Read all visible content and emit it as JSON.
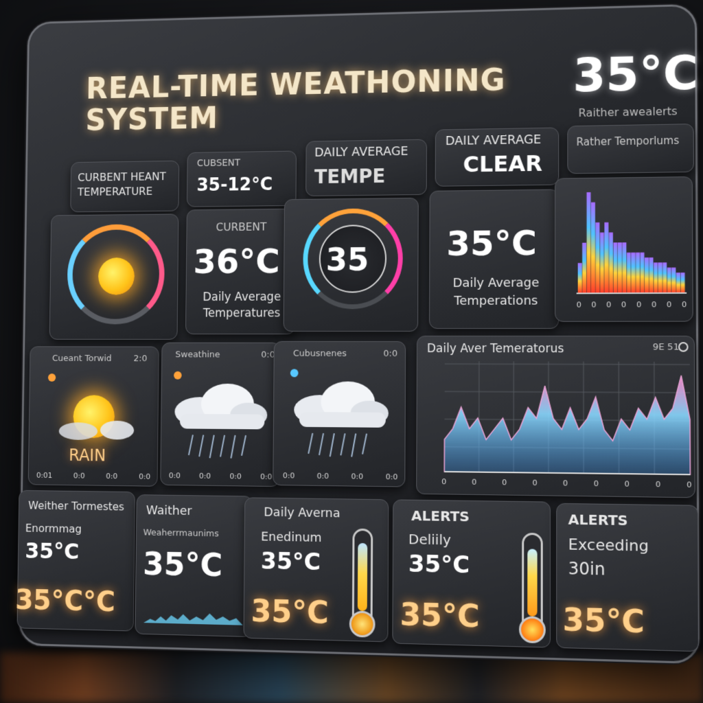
{
  "app": {
    "title": "REAL-TIME WEATHONING SYSTEM",
    "header_temp": "35°C",
    "header_alerts": "Raither awealerts"
  },
  "row1": {
    "c1": {
      "label": "CURBENT HEANT TEMPERATURE"
    },
    "c2": {
      "label": "CUBSENT",
      "value": "35-12°C"
    },
    "c3": {
      "label": "DAILY AVERAGE",
      "value": "TEMPE"
    },
    "c4": {
      "label": "DAILY AVERAGE",
      "value": "CLEAR"
    },
    "c5": {
      "label": "Rather Temporlums"
    }
  },
  "row2": {
    "c2": {
      "label": "CURBENT",
      "value": "36°C",
      "caption": "Daily Average Temperatures"
    },
    "c3": {
      "value": "35"
    },
    "c4": {
      "value": "35°C",
      "caption": "Daily Average Temperations"
    },
    "histogram_ticks": [
      "0",
      "0",
      "0",
      "0",
      "0",
      "0",
      "0",
      "0"
    ]
  },
  "row3": {
    "w1": {
      "label": "Cueant Torwid",
      "badge": "2:0",
      "caption": "RAIN",
      "ticks": [
        "0:01",
        "0:0",
        "0:0",
        "0:0"
      ]
    },
    "w2": {
      "label": "Sweathine",
      "badge": "0:0",
      "ticks": [
        "0:0",
        "0:0",
        "0:0",
        "0:0"
      ]
    },
    "w3": {
      "label": "Cubusnenes",
      "badge": "0:0",
      "ticks": [
        "0:0",
        "0:0",
        "0:0",
        "0:0"
      ]
    },
    "chart_title": "Daily Aver Temeratorus",
    "chart_badge": "9E 51",
    "chart_ticks": [
      "0",
      "0",
      "0",
      "0",
      "0",
      "0",
      "0",
      "0",
      "0"
    ]
  },
  "row4": {
    "a": {
      "title": "Weither Tormestes",
      "label": "Enormmag",
      "value": "35°C",
      "big": "35°C°C"
    },
    "b": {
      "title": "Waither",
      "label": "Weaherrmaunims",
      "value": "35°C"
    },
    "c": {
      "title": "Daily Averna",
      "label": "Enedinum",
      "value": "35°C",
      "big": "35°C"
    },
    "d": {
      "title": "ALERTS",
      "label": "Deliily",
      "value": "35°C",
      "big": "35°C"
    },
    "e": {
      "title": "ALERTS",
      "label": "Exceeding",
      "value": "30in",
      "big": "35°C"
    }
  },
  "colors": {
    "accent": "#ffb84d",
    "panel": "#24262a",
    "glow": "#ffa040"
  },
  "chart_data": [
    {
      "type": "area",
      "x": [
        1,
        2,
        3,
        4,
        5,
        6,
        7,
        8,
        9,
        10,
        11,
        12,
        13,
        14,
        15,
        16,
        17,
        18,
        19,
        20,
        21,
        22,
        23,
        24
      ],
      "values": [
        3,
        5,
        10,
        9,
        7,
        6,
        7,
        6,
        5,
        5,
        5,
        4,
        4,
        4,
        4,
        3.5,
        3.5,
        3,
        3,
        3,
        2.5,
        2.5,
        2,
        2
      ],
      "title": "Rather Temporlums"
    },
    {
      "type": "area",
      "x": [
        1,
        2,
        3,
        4,
        5,
        6,
        7,
        8,
        9,
        10,
        11,
        12,
        13,
        14,
        15,
        16,
        17,
        18,
        19,
        20,
        21,
        22,
        23,
        24,
        25,
        26,
        27,
        28,
        29,
        30
      ],
      "values": [
        3,
        4,
        6,
        4,
        5,
        3,
        4,
        5,
        3,
        4,
        6,
        5,
        8,
        5,
        4,
        6,
        4,
        5,
        7,
        4,
        3,
        5,
        4,
        6,
        5,
        7,
        5,
        6,
        9,
        5
      ],
      "title": "Daily Aver Temeratorus"
    }
  ]
}
